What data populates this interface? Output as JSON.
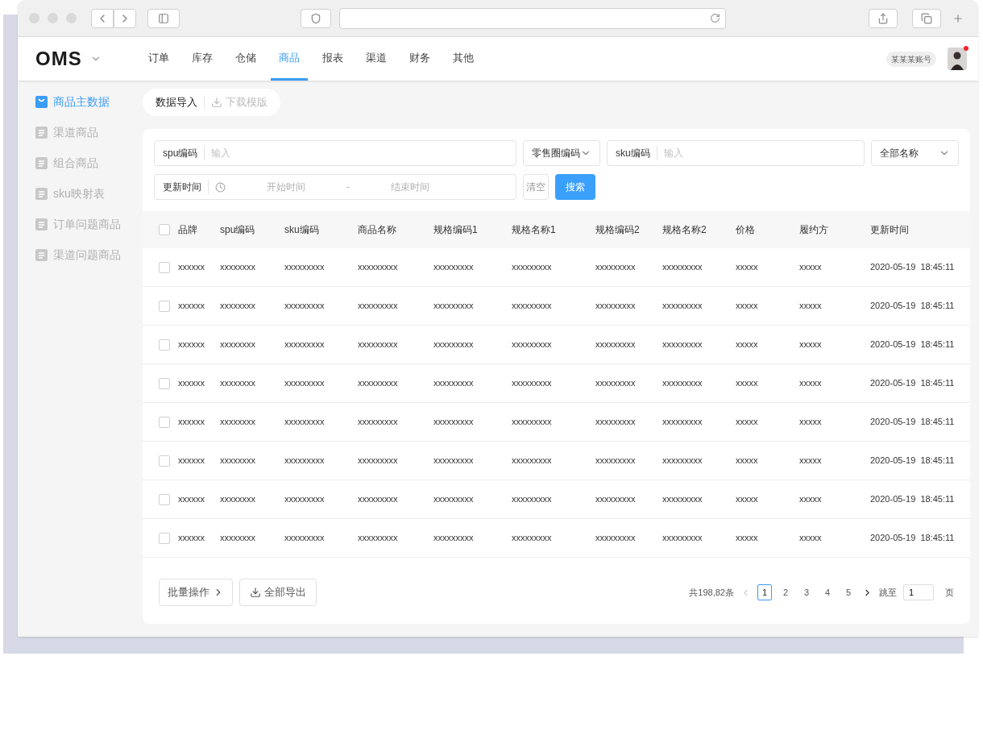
{
  "app": {
    "logo": "OMS",
    "nav": [
      {
        "label": "订单",
        "selected": false
      },
      {
        "label": "库存",
        "selected": false
      },
      {
        "label": "仓储",
        "selected": false
      },
      {
        "label": "商品",
        "selected": true
      },
      {
        "label": "报表",
        "selected": false
      },
      {
        "label": "渠道",
        "selected": false
      },
      {
        "label": "财务",
        "selected": false
      },
      {
        "label": "其他",
        "selected": false
      }
    ],
    "account": "某某某账号",
    "notification": true
  },
  "sidebar": {
    "items": [
      {
        "label": "商品主数据",
        "selected": true
      },
      {
        "label": "渠道商品",
        "selected": false
      },
      {
        "label": "组合商品",
        "selected": false
      },
      {
        "label": "sku映射表",
        "selected": false
      },
      {
        "label": "订单问题商品",
        "selected": false
      },
      {
        "label": "渠道问题商品",
        "selected": false
      }
    ]
  },
  "actions": {
    "import": "数据导入",
    "template": "下载模版"
  },
  "filters": {
    "spu": {
      "label": "spu编码",
      "placeholder": "输入"
    },
    "retail_select": "零售圈编码",
    "sku": {
      "label": "sku编码",
      "placeholder": "输入"
    },
    "name_select": "全部名称",
    "time": {
      "label": "更新时间",
      "start_placeholder": "开始时间",
      "separator": "-",
      "end_placeholder": "结束时间"
    },
    "clear": "清空",
    "search": "搜索"
  },
  "table": {
    "columns": [
      "品牌",
      "spu编码",
      "sku编码",
      "商品名称",
      "规格编码1",
      "规格名称1",
      "规格编码2",
      "规格名称2",
      "价格",
      "履约方",
      "更新时间"
    ],
    "header_checked": false,
    "rows": [
      {
        "checked": false,
        "cells": [
          "xxxxxx",
          "xxxxxxxx",
          "xxxxxxxxx",
          "xxxxxxxxx",
          "xxxxxxxxx",
          "xxxxxxxxx",
          "xxxxxxxxx",
          "xxxxxxxxx",
          "xxxxx",
          "xxxxx",
          "2020-05-19  18:45:11"
        ]
      },
      {
        "checked": false,
        "cells": [
          "xxxxxx",
          "xxxxxxxx",
          "xxxxxxxxx",
          "xxxxxxxxx",
          "xxxxxxxxx",
          "xxxxxxxxx",
          "xxxxxxxxx",
          "xxxxxxxxx",
          "xxxxx",
          "xxxxx",
          "2020-05-19  18:45:11"
        ]
      },
      {
        "checked": false,
        "cells": [
          "xxxxxx",
          "xxxxxxxx",
          "xxxxxxxxx",
          "xxxxxxxxx",
          "xxxxxxxxx",
          "xxxxxxxxx",
          "xxxxxxxxx",
          "xxxxxxxxx",
          "xxxxx",
          "xxxxx",
          "2020-05-19  18:45:11"
        ]
      },
      {
        "checked": false,
        "cells": [
          "xxxxxx",
          "xxxxxxxx",
          "xxxxxxxxx",
          "xxxxxxxxx",
          "xxxxxxxxx",
          "xxxxxxxxx",
          "xxxxxxxxx",
          "xxxxxxxxx",
          "xxxxx",
          "xxxxx",
          "2020-05-19  18:45:11"
        ]
      },
      {
        "checked": false,
        "cells": [
          "xxxxxx",
          "xxxxxxxx",
          "xxxxxxxxx",
          "xxxxxxxxx",
          "xxxxxxxxx",
          "xxxxxxxxx",
          "xxxxxxxxx",
          "xxxxxxxxx",
          "xxxxx",
          "xxxxx",
          "2020-05-19  18:45:11"
        ]
      },
      {
        "checked": false,
        "cells": [
          "xxxxxx",
          "xxxxxxxx",
          "xxxxxxxxx",
          "xxxxxxxxx",
          "xxxxxxxxx",
          "xxxxxxxxx",
          "xxxxxxxxx",
          "xxxxxxxxx",
          "xxxxx",
          "xxxxx",
          "2020-05-19  18:45:11"
        ]
      },
      {
        "checked": false,
        "cells": [
          "xxxxxx",
          "xxxxxxxx",
          "xxxxxxxxx",
          "xxxxxxxxx",
          "xxxxxxxxx",
          "xxxxxxxxx",
          "xxxxxxxxx",
          "xxxxxxxxx",
          "xxxxx",
          "xxxxx",
          "2020-05-19  18:45:11"
        ]
      },
      {
        "checked": false,
        "cells": [
          "xxxxxx",
          "xxxxxxxx",
          "xxxxxxxxx",
          "xxxxxxxxx",
          "xxxxxxxxx",
          "xxxxxxxxx",
          "xxxxxxxxx",
          "xxxxxxxxx",
          "xxxxx",
          "xxxxx",
          "2020-05-19  18:45:11"
        ]
      }
    ]
  },
  "footer": {
    "batch": "批量操作",
    "export": "全部导出",
    "total": "共198,82条",
    "pages": [
      {
        "label": "1",
        "selected": true
      },
      {
        "label": "2",
        "selected": false
      },
      {
        "label": "3",
        "selected": false
      },
      {
        "label": "4",
        "selected": false
      },
      {
        "label": "5",
        "selected": false
      }
    ],
    "goto": "跳至",
    "goto_value": "1",
    "page_unit": "页"
  }
}
